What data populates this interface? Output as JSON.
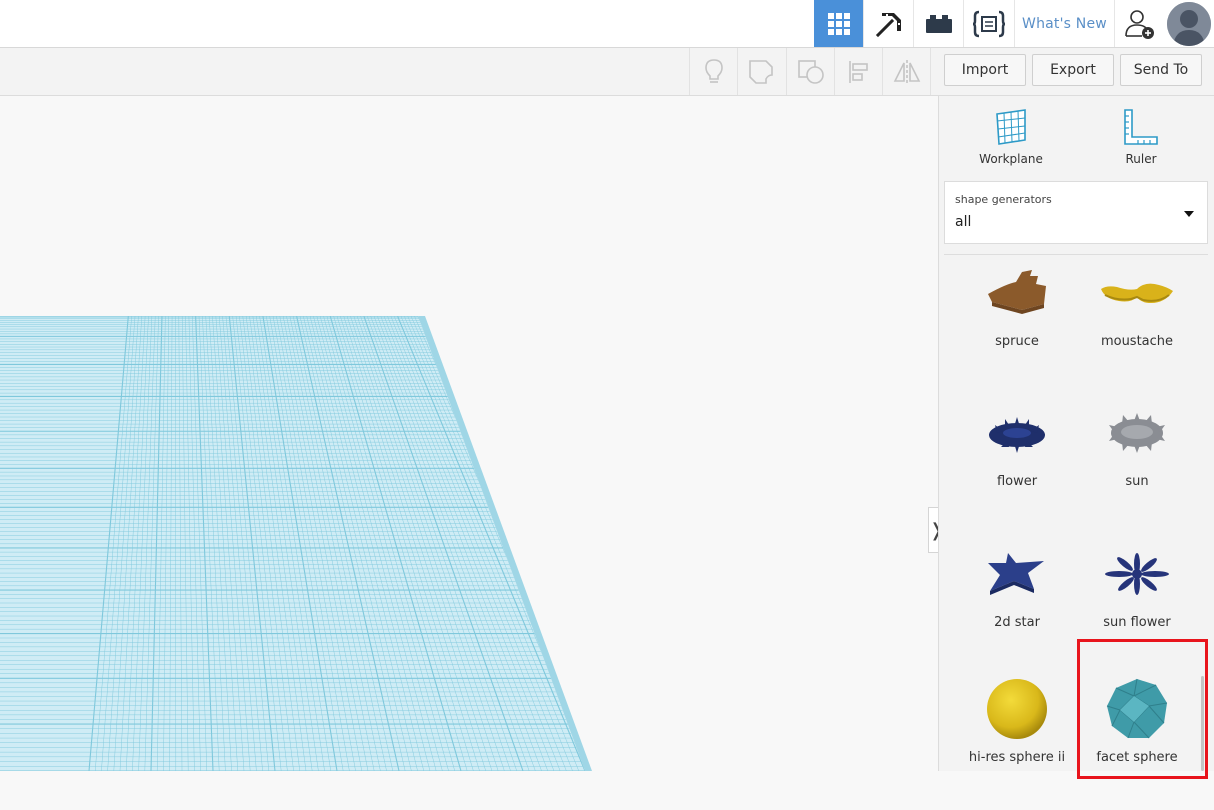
{
  "topbar": {
    "items": [
      {
        "name": "3d-design-grid-icon",
        "active": true
      },
      {
        "name": "minecraft-pickaxe-icon"
      },
      {
        "name": "lego-brick-icon"
      },
      {
        "name": "codeblocks-icon"
      }
    ],
    "whats_new": "What's New",
    "icons": {
      "add_user": "add-user-icon",
      "avatar": "user-avatar"
    }
  },
  "toolbar": {
    "icons": [
      "lightbulb-icon",
      "group-icon",
      "ungroup-icon",
      "align-icon",
      "mirror-icon"
    ],
    "import_label": "Import",
    "export_label": "Export",
    "send_to_label": "Send To"
  },
  "panel": {
    "tools": {
      "workplane": "Workplane",
      "ruler": "Ruler"
    },
    "category": {
      "caption": "shape generators",
      "value": "all"
    },
    "shapes": [
      {
        "label": "spruce"
      },
      {
        "label": "moustache"
      },
      {
        "label": "flower"
      },
      {
        "label": "sun"
      },
      {
        "label": "2d star"
      },
      {
        "label": "sun flower"
      },
      {
        "label": "hi-res sphere ii"
      },
      {
        "label": "facet sphere"
      }
    ],
    "collapse_glyph": "❭"
  },
  "colors": {
    "accent": "#4a90d9",
    "grid_line": "#7fc8dc",
    "grid_fill": "#c8eaf4",
    "highlight": "#e8141c"
  }
}
